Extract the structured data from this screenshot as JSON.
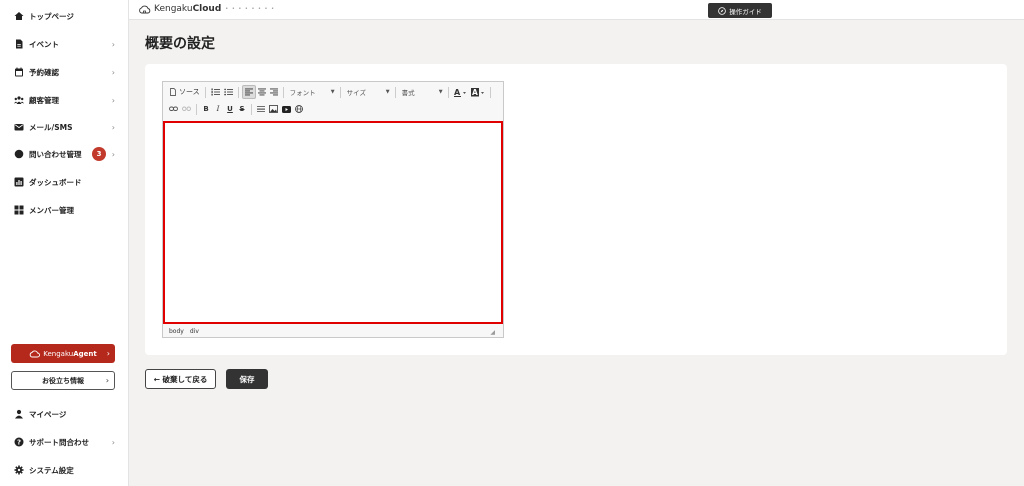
{
  "sidebar": {
    "items": [
      {
        "label": "トップページ",
        "icon": "home-icon",
        "chevron": ""
      },
      {
        "label": "イベント",
        "icon": "document-icon",
        "chevron": "›"
      },
      {
        "label": "予約確認",
        "icon": "calendar-icon",
        "chevron": "›"
      },
      {
        "label": "顧客管理",
        "icon": "people-icon",
        "chevron": "›"
      },
      {
        "label": "メール/SMS",
        "icon": "mail-icon",
        "chevron": "›"
      },
      {
        "label": "問い合わせ管理",
        "icon": "chat-icon",
        "chevron": "›",
        "badge": "3"
      },
      {
        "label": "ダッシュボード",
        "icon": "chart-icon",
        "chevron": ""
      },
      {
        "label": "メンバー管理",
        "icon": "grid-icon",
        "chevron": ""
      }
    ],
    "agent_button": {
      "prefix": "Kengaku",
      "name": "Agent",
      "chevron": "›"
    },
    "useful_button": {
      "label": "お役立ち情報",
      "chevron": "›"
    },
    "bottom_items": [
      {
        "label": "マイページ",
        "icon": "user-icon",
        "chevron": ""
      },
      {
        "label": "サポート問合わせ",
        "icon": "help-icon",
        "chevron": "›"
      },
      {
        "label": "システム設定",
        "icon": "gear-icon",
        "chevron": ""
      }
    ]
  },
  "topbar": {
    "logo_prefix": "Kengaku",
    "logo_name": "Cloud",
    "logo_dots": "• • • • • • • •",
    "guide_label": "操作ガイド"
  },
  "main": {
    "title": "概要の設定",
    "editor": {
      "source_label": "ソース",
      "font_label": "フォント",
      "size_label": "サイズ",
      "format_label": "書式",
      "path": [
        "body",
        "div"
      ]
    },
    "back_button": "← 破棄して戻る",
    "save_button": "保存"
  },
  "colors": {
    "accent": "#b5291c",
    "badge": "#c23a2b",
    "highlight_border": "#e00000",
    "dark_button": "#333333"
  }
}
